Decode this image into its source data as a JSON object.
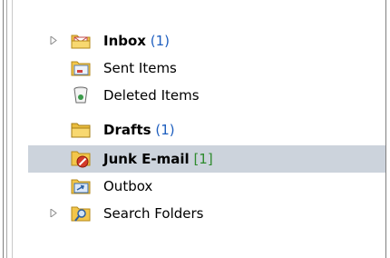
{
  "folders": [
    {
      "label": "Inbox",
      "count": "(1)",
      "bold": true,
      "expandable": true,
      "icon": "inbox-folder-icon"
    },
    {
      "label": "Sent Items",
      "count": "",
      "bold": false,
      "expandable": false,
      "icon": "sent-items-folder-icon"
    },
    {
      "label": "Deleted Items",
      "count": "",
      "bold": false,
      "expandable": false,
      "icon": "deleted-items-trash-icon"
    },
    {
      "label": "Drafts",
      "count": "(1)",
      "bold": true,
      "expandable": false,
      "icon": "drafts-folder-icon"
    },
    {
      "label": "Junk E-mail",
      "count": "[1]",
      "bold": true,
      "expandable": false,
      "icon": "junk-email-folder-icon",
      "selected": true
    },
    {
      "label": "Outbox",
      "count": "",
      "bold": false,
      "expandable": false,
      "icon": "outbox-folder-icon"
    },
    {
      "label": "Search Folders",
      "count": "",
      "bold": false,
      "expandable": true,
      "icon": "search-folders-icon"
    }
  ],
  "colors": {
    "selected_row": "#ccd3dc",
    "unread_count_blue": "#1f5fbf",
    "junk_count_green": "#2e8b2e"
  }
}
